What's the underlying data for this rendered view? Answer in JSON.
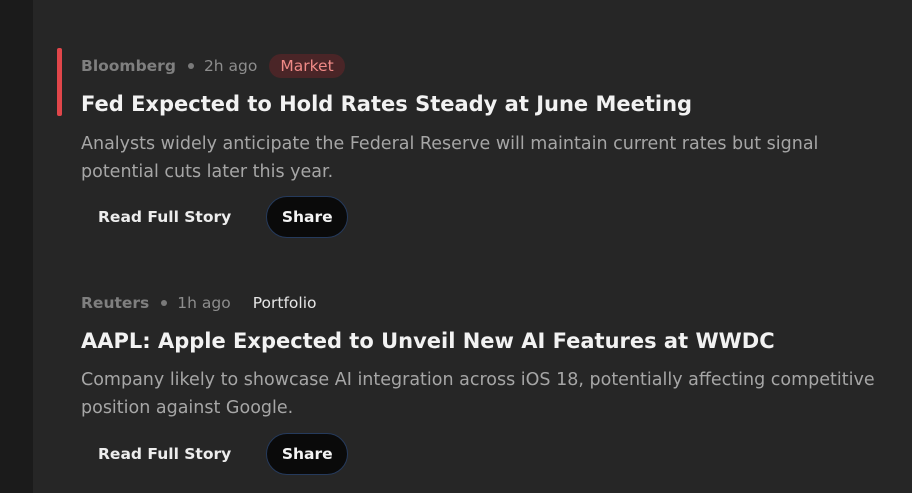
{
  "colors": {
    "accent_bar": "#e0464a",
    "market_tag_bg": "#4a2527",
    "market_tag_text": "#ef8a86",
    "background": "#262626"
  },
  "articles": [
    {
      "source": "Bloomberg",
      "time": "2h ago",
      "tag": "Market",
      "headline": "Fed Expected to Hold Rates Steady at June Meeting",
      "summary": "Analysts widely anticipate the Federal Reserve will maintain current rates but signal potential cuts later this year.",
      "read_label": "Read Full Story",
      "share_label": "Share"
    },
    {
      "source": "Reuters",
      "time": "1h ago",
      "tag": "Portfolio",
      "headline": "AAPL: Apple Expected to Unveil New AI Features at WWDC",
      "summary": "Company likely to showcase AI integration across iOS 18, potentially affecting competitive position against Google.",
      "read_label": "Read Full Story",
      "share_label": "Share"
    }
  ]
}
